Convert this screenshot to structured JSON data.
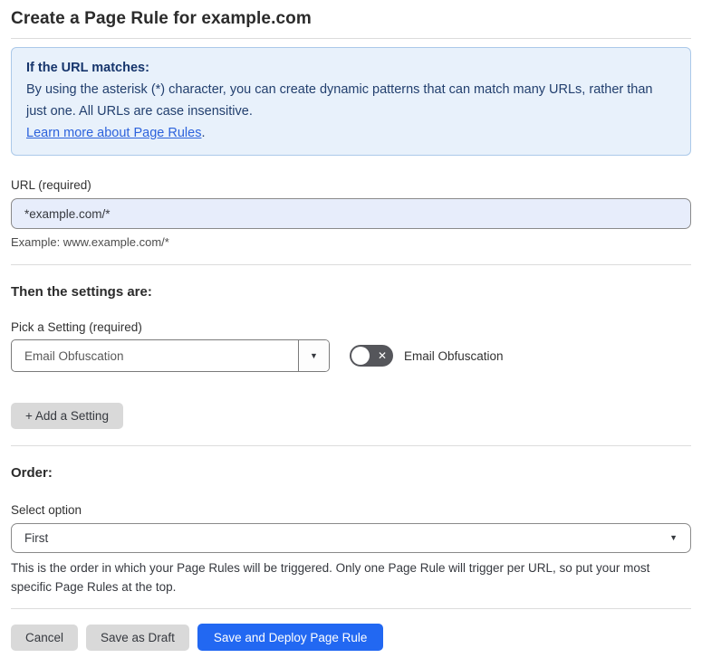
{
  "page": {
    "title": "Create a Page Rule for example.com"
  },
  "info_box": {
    "heading": "If the URL matches:",
    "body": "By using the asterisk (*) character, you can create dynamic patterns that can match many URLs, rather than just one. All URLs are case insensitive.",
    "link_label": "Learn more about Page Rules",
    "link_suffix": "."
  },
  "url_field": {
    "label": "URL (required)",
    "value": "*example.com/*",
    "example": "Example: www.example.com/*"
  },
  "settings_section": {
    "heading": "Then the settings are:",
    "picker_label": "Pick a Setting (required)",
    "picker_value": "Email Obfuscation",
    "toggle_label": "Email Obfuscation",
    "toggle_state": "off",
    "add_setting_label": "+ Add a Setting"
  },
  "order_section": {
    "heading": "Order:",
    "select_label": "Select option",
    "select_value": "First",
    "help_text": "This is the order in which your Page Rules will be triggered. Only one Page Rule will trigger per URL, so put your most specific Page Rules at the top."
  },
  "footer": {
    "cancel_label": "Cancel",
    "save_draft_label": "Save as Draft",
    "save_deploy_label": "Save and Deploy Page Rule"
  },
  "icons": {
    "dropdown_caret": "▼",
    "toggle_off_x": "✕"
  },
  "colors": {
    "accent_blue": "#2268f2",
    "info_box_bg": "#e8f1fb",
    "info_box_border": "#abc9e9",
    "info_text_navy": "#223f6e",
    "link_blue": "#2c62dc",
    "url_input_bg": "#e7edfb",
    "gray_button_bg": "#d9d9d9",
    "toggle_off_bg": "#55565b",
    "divider": "#dcdcdc"
  }
}
